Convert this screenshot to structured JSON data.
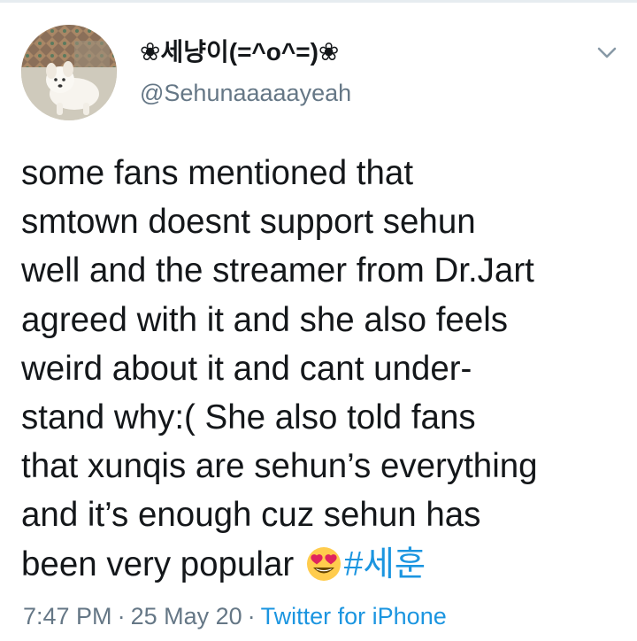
{
  "user": {
    "display_name": "❀세냥이(=^o^=)❀",
    "handle": "@Sehunaaaaayeah",
    "avatar_icon": "dog-avatar"
  },
  "menu": {
    "icon": "chevron-down-icon"
  },
  "tweet": {
    "lines": [
      "some fans mentioned that",
      "smtown doesnt support sehun",
      "well and the streamer from Dr.Jart",
      "agreed with it and she also feels",
      "weird about it and cant under-",
      "stand why:( She also told fans",
      "that xunqis are sehun’s everything",
      "and it’s enough cuz sehun has"
    ],
    "last_line_text": "been very popular ",
    "emoji": "heart-eyes-emoji",
    "hashtag": "#세훈"
  },
  "meta": {
    "time": "7:47 PM",
    "separator": "·",
    "date": "25 May 20",
    "source": "Twitter for iPhone"
  },
  "colors": {
    "text": "#14171a",
    "secondary": "#657786",
    "link": "#1b95e0"
  }
}
